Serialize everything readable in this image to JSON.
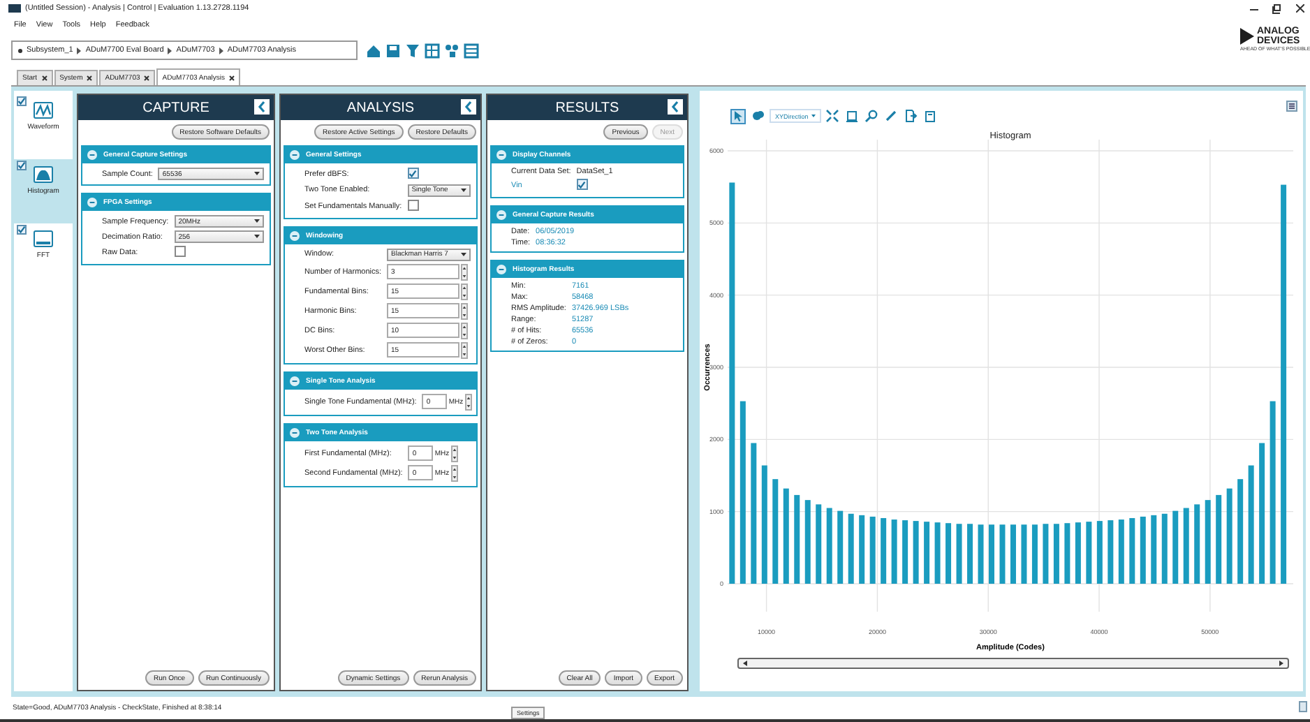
{
  "window": {
    "title": "(Untitled Session) - Analysis | Control | Evaluation 1.13.2728.1194"
  },
  "menu": [
    "File",
    "View",
    "Tools",
    "Help",
    "Feedback"
  ],
  "logo": {
    "line1": "ANALOG",
    "line2": "DEVICES",
    "tagline": "AHEAD OF WHAT'S POSSIBLE"
  },
  "breadcrumb": [
    "Subsystem_1",
    "ADuM7700 Eval Board",
    "ADuM7703",
    "ADuM7703 Analysis"
  ],
  "tabs": [
    {
      "label": "Start",
      "selected": false
    },
    {
      "label": "System",
      "selected": false
    },
    {
      "label": "ADuM7703",
      "selected": false
    },
    {
      "label": "ADuM7703 Analysis",
      "selected": true
    }
  ],
  "nav": [
    {
      "kind": "waveform",
      "label": "Waveform",
      "checked": true,
      "selected": false
    },
    {
      "kind": "histogram",
      "label": "Histogram",
      "checked": true,
      "selected": true
    },
    {
      "kind": "fft",
      "label": "FFT",
      "checked": true,
      "selected": false
    }
  ],
  "panels": [
    {
      "title": "CAPTURE",
      "top_buttons": [
        {
          "label": "Restore Software Defaults",
          "disabled": false
        }
      ],
      "sections": [
        {
          "title": "General Capture Settings",
          "rows": [
            {
              "kind": "dropdown",
              "label": "Sample Count:",
              "value": "65536"
            }
          ]
        },
        {
          "title": "FPGA Settings",
          "rows": [
            {
              "kind": "dropdown",
              "label": "Sample Frequency:",
              "value": "20MHz"
            },
            {
              "kind": "dropdown",
              "label": "Decimation Ratio:",
              "value": "256"
            },
            {
              "kind": "checkbox",
              "label": "Raw Data:",
              "checked": false
            }
          ]
        }
      ],
      "bottom_buttons": [
        "Run Once",
        "Run Continuously"
      ]
    },
    {
      "title": "ANALYSIS",
      "top_buttons": [
        {
          "label": "Restore Active Settings",
          "disabled": false
        },
        {
          "label": "Restore Defaults",
          "disabled": false
        }
      ],
      "sections": [
        {
          "title": "General Settings",
          "rows": [
            {
              "kind": "checkbox",
              "label": "Prefer dBFS:",
              "checked": true
            },
            {
              "kind": "dropdown",
              "label": "Two Tone Enabled:",
              "value": "Single Tone"
            },
            {
              "kind": "checkbox",
              "label": "Set Fundamentals Manually:",
              "checked": false
            }
          ]
        },
        {
          "title": "Windowing",
          "rows": [
            {
              "kind": "dropdown",
              "label": "Window:",
              "value": "Blackman Harris 7"
            },
            {
              "kind": "spinner",
              "label": "Number of Harmonics:",
              "value": "3"
            },
            {
              "kind": "spinner",
              "label": "Fundamental Bins:",
              "value": "15"
            },
            {
              "kind": "spinner",
              "label": "Harmonic Bins:",
              "value": "15"
            },
            {
              "kind": "spinner",
              "label": "DC Bins:",
              "value": "10"
            },
            {
              "kind": "spinner",
              "label": "Worst Other Bins:",
              "value": "15"
            }
          ]
        },
        {
          "title": "Single Tone Analysis",
          "rows": [
            {
              "kind": "spinner",
              "label": "Single Tone Fundamental (MHz):",
              "value": "0",
              "unit": "MHz"
            }
          ]
        },
        {
          "title": "Two Tone Analysis",
          "rows": [
            {
              "kind": "spinner",
              "label": "First Fundamental (MHz):",
              "value": "0",
              "unit": "MHz"
            },
            {
              "kind": "spinner",
              "label": "Second Fundamental (MHz):",
              "value": "0",
              "unit": "MHz"
            }
          ]
        }
      ],
      "bottom_buttons": [
        "Dynamic Settings",
        "Rerun Analysis"
      ]
    },
    {
      "title": "RESULTS",
      "top_buttons": [
        {
          "label": "Previous",
          "disabled": false
        },
        {
          "label": "Next",
          "disabled": true
        }
      ],
      "sections": [
        {
          "title": "Display Channels",
          "rows": [
            {
              "kind": "text",
              "label": "Current Data Set:",
              "value": "DataSet_1"
            },
            {
              "kind": "channel",
              "label": "Vin",
              "checked": true
            }
          ]
        },
        {
          "title": "General Capture Results",
          "rows": [
            {
              "kind": "value",
              "label": "Date:",
              "value": "06/05/2019"
            },
            {
              "kind": "value",
              "label": "Time:",
              "value": "08:36:32"
            }
          ]
        },
        {
          "title": "Histogram Results",
          "rows": [
            {
              "kind": "value",
              "label": "Min:",
              "value": "7161"
            },
            {
              "kind": "value",
              "label": "Max:",
              "value": "58468"
            },
            {
              "kind": "value",
              "label": "RMS Amplitude:",
              "value": "37426.969 LSBs"
            },
            {
              "kind": "value",
              "label": "Range:",
              "value": "51287"
            },
            {
              "kind": "value",
              "label": "# of Hits:",
              "value": "65536"
            },
            {
              "kind": "value",
              "label": "# of Zeros:",
              "value": "0"
            }
          ]
        }
      ],
      "bottom_buttons": [
        "Clear All",
        "Import",
        "Export"
      ]
    }
  ],
  "chart_tools": [
    {
      "kind": "select",
      "selected": true
    },
    {
      "kind": "pan",
      "selected": false
    },
    {
      "kind": "direction",
      "label": "XYDirection",
      "selected": false
    },
    {
      "kind": "fit",
      "selected": false
    },
    {
      "kind": "zoom_box",
      "selected": false
    },
    {
      "kind": "zoom",
      "selected": false
    },
    {
      "kind": "pen",
      "selected": false
    },
    {
      "kind": "export",
      "selected": false
    },
    {
      "kind": "copy",
      "selected": false
    }
  ],
  "chart": {
    "chart_data": {
      "type": "bar",
      "title": "Histogram",
      "xlabel": "Amplitude (Codes)",
      "ylabel": "Occurrences",
      "x": [
        6900,
        7875,
        8850,
        9825,
        10800,
        11775,
        12750,
        13725,
        14700,
        15675,
        16650,
        17625,
        18600,
        19575,
        20550,
        21525,
        22500,
        23475,
        24450,
        25425,
        26400,
        27375,
        28350,
        29325,
        30300,
        31275,
        32250,
        33225,
        34200,
        35175,
        36150,
        37125,
        38100,
        39075,
        40050,
        41025,
        42000,
        42975,
        43950,
        44925,
        45900,
        46875,
        47850,
        48825,
        49800,
        50775,
        51750,
        52725,
        53700,
        54675,
        55650,
        56625
      ],
      "grid": true,
      "series": [
        {
          "color": "#1a9cbf",
          "values": [
            5560,
            2530,
            1950,
            1640,
            1450,
            1320,
            1230,
            1160,
            1100,
            1050,
            1010,
            970,
            950,
            930,
            910,
            890,
            880,
            870,
            860,
            850,
            840,
            830,
            830,
            820,
            820,
            820,
            820,
            820,
            820,
            830,
            830,
            840,
            850,
            860,
            870,
            880,
            890,
            910,
            930,
            950,
            970,
            1010,
            1050,
            1100,
            1160,
            1230,
            1320,
            1450,
            1640,
            1950,
            2530,
            5530
          ]
        }
      ],
      "xlim": [
        6500,
        57500
      ],
      "ylim": [
        0,
        6000
      ],
      "xticks": [
        10000,
        20000,
        30000,
        40000,
        50000
      ],
      "yticks": [
        0,
        1000,
        2000,
        3000,
        4000,
        5000,
        6000
      ]
    }
  },
  "status_bar": {
    "text": "State=Good, ADuM7703 Analysis - CheckState, Finished at 8:38:14",
    "settings": "Settings"
  }
}
